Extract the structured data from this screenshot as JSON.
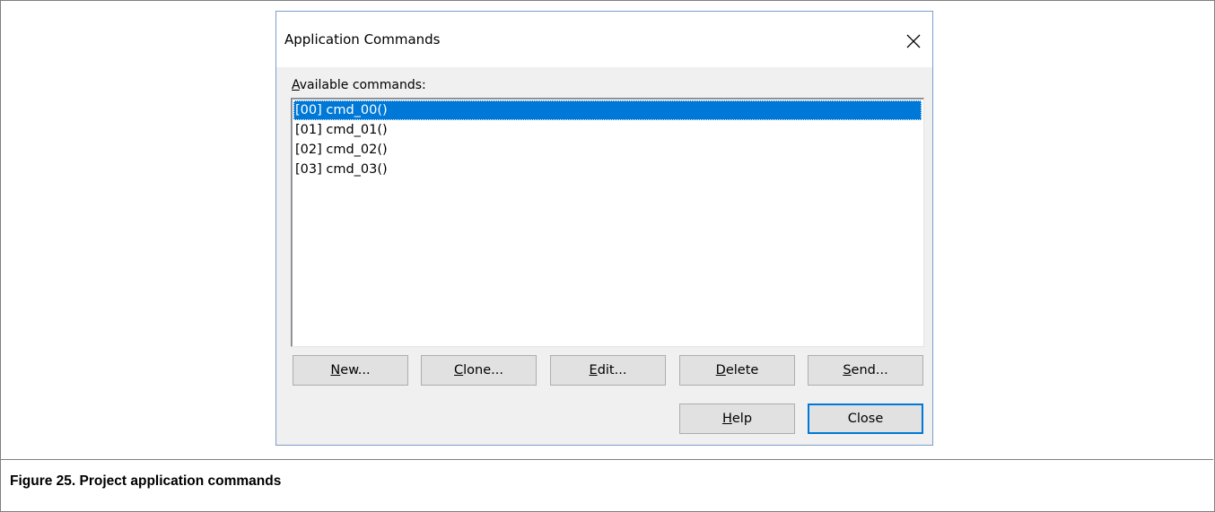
{
  "dialog": {
    "title": "Application Commands",
    "close_icon": "close-icon",
    "list_label_accel": "A",
    "list_label_rest": "vailable commands:",
    "commands": [
      "[00] cmd_00()",
      "[01] cmd_01()",
      "[02] cmd_02()",
      "[03] cmd_03()"
    ],
    "selected_index": 0,
    "buttons": {
      "new": {
        "accel": "N",
        "rest": "ew..."
      },
      "clone": {
        "accel": "C",
        "rest": "lone..."
      },
      "edit": {
        "accel": "E",
        "rest": "dit..."
      },
      "delete": {
        "accel": "D",
        "rest": "elete"
      },
      "send": {
        "accel": "S",
        "rest": "end..."
      },
      "help": {
        "accel": "H",
        "rest": "elp"
      },
      "close": {
        "label": "Close"
      }
    }
  },
  "caption": "Figure 25. Project application commands",
  "colors": {
    "selection": "#0078d7",
    "dialog_bg": "#f0f0f0",
    "dialog_border": "#7a9ecd",
    "button_bg": "#e1e1e1"
  }
}
